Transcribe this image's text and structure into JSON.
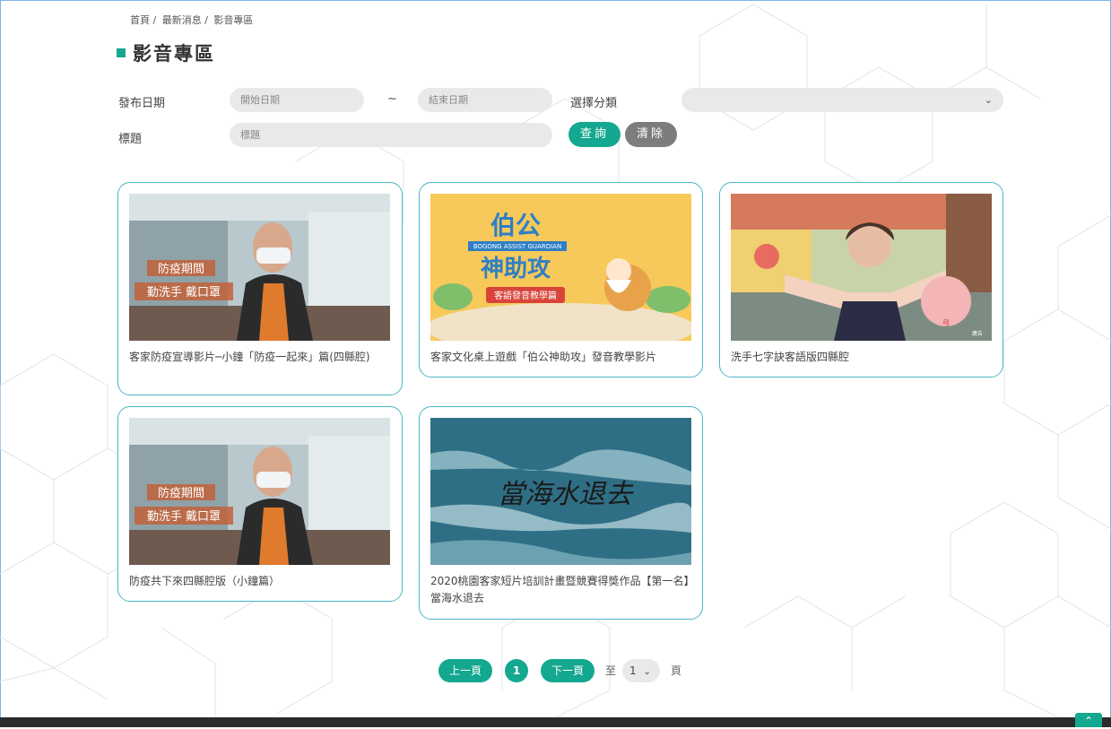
{
  "breadcrumb": [
    "首頁 /",
    "最新消息 /",
    "影音專區"
  ],
  "page_title": "影音專區",
  "filters": {
    "date_label": "發布日期",
    "start_placeholder": "開始日期",
    "range_sep": "~",
    "end_placeholder": "結束日期",
    "category_label": "選擇分類",
    "category_value": "",
    "title_label": "標題",
    "title_placeholder": "標題",
    "query_label": "查詢",
    "clear_label": "清除"
  },
  "videos": [
    {
      "title": "客家防疫宣導影片─小鐘「防疫一起來」篇(四縣腔)",
      "overlay": [
        "防疫期間",
        "勤洗手 戴口罩"
      ]
    },
    {
      "title": "客家文化桌上遊戲「伯公神助攻」發音教學影片",
      "overlay": [
        "伯公",
        "神助攻",
        "BOGONG ASSIST GUARDIAN",
        "客語發音教學篇"
      ]
    },
    {
      "title": "洗手七字訣客語版四縣腔",
      "overlay": [
        "弓",
        "廣告"
      ]
    },
    {
      "title": "防疫共下來四縣腔版（小鐘篇）",
      "overlay": [
        "防疫期間",
        "勤洗手 戴口罩"
      ]
    },
    {
      "title": "2020桃園客家短片培訓計畫暨競賽得獎作品【第一名】當海水退去",
      "overlay": [
        "當海水退去"
      ]
    }
  ],
  "pagination": {
    "prev_label": "上一頁",
    "current_page": "1",
    "next_label": "下一頁",
    "to_label": "至",
    "page_select": "1",
    "page_suffix": "頁"
  },
  "colors": {
    "accent": "#13a88f",
    "card_border": "#4ab7c4",
    "clear_button": "#7d7d7d"
  }
}
